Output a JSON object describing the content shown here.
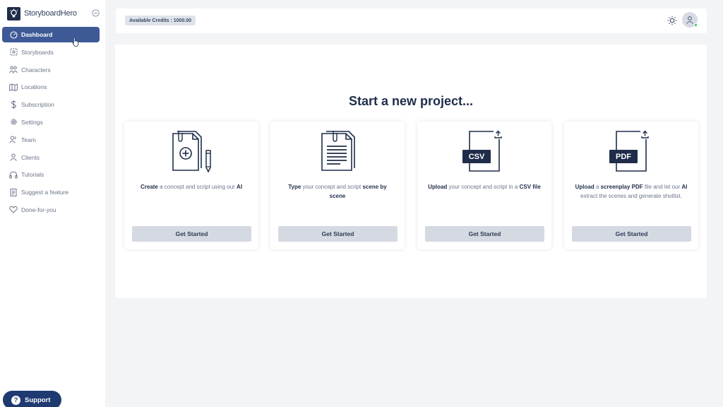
{
  "brand": {
    "name": "StoryboardHero"
  },
  "nav": {
    "items": [
      {
        "label": "Dashboard",
        "icon": "dashboard-icon",
        "active": true
      },
      {
        "label": "Storyboards",
        "icon": "storyboards-icon"
      },
      {
        "label": "Characters",
        "icon": "characters-icon"
      },
      {
        "label": "Locations",
        "icon": "map-icon"
      },
      {
        "label": "Subscription",
        "icon": "dollar-icon"
      },
      {
        "label": "Settings",
        "icon": "gear-icon"
      },
      {
        "label": "Team",
        "icon": "team-icon"
      },
      {
        "label": "Clients",
        "icon": "clients-icon"
      },
      {
        "label": "Tutorials",
        "icon": "headphones-icon"
      },
      {
        "label": "Suggest a feature",
        "icon": "clipboard-icon"
      },
      {
        "label": "Done-for-you",
        "icon": "heart-icon"
      }
    ]
  },
  "support": {
    "label": "Support",
    "icon_glyph": "?"
  },
  "header": {
    "credits": "Available Credits : 1000.00"
  },
  "main": {
    "title": "Start a new project...",
    "cards": [
      {
        "icon": "create-document-icon",
        "desc_parts": [
          {
            "text": "Create",
            "bold": true
          },
          {
            "text": " a concept and script using our ",
            "bold": false
          },
          {
            "text": "AI",
            "bold": true
          }
        ],
        "button": "Get Started"
      },
      {
        "icon": "type-document-icon",
        "desc_parts": [
          {
            "text": "Type",
            "bold": true
          },
          {
            "text": " your concept and script ",
            "bold": false
          },
          {
            "text": "scene by scene",
            "bold": true
          }
        ],
        "button": "Get Started"
      },
      {
        "icon": "csv-upload-icon",
        "badge": "CSV",
        "desc_parts": [
          {
            "text": "Upload",
            "bold": true
          },
          {
            "text": " your concept and script in a ",
            "bold": false
          },
          {
            "text": "CSV file",
            "bold": true
          }
        ],
        "button": "Get Started"
      },
      {
        "icon": "pdf-upload-icon",
        "badge": "PDF",
        "desc_parts": [
          {
            "text": "Upload",
            "bold": true
          },
          {
            "text": " a ",
            "bold": false
          },
          {
            "text": "screenplay PDF",
            "bold": true
          },
          {
            "text": " file and let our ",
            "bold": false
          },
          {
            "text": "AI",
            "bold": true
          },
          {
            "text": " extract the scenes and generate shotlist.",
            "bold": false
          }
        ],
        "button": "Get Started"
      }
    ]
  },
  "colors": {
    "primary": "#1f2d4a",
    "active_nav": "#3e5a96",
    "support": "#1f3a70",
    "button_bg": "#d5d9e1",
    "status_online": "#22c55e"
  }
}
